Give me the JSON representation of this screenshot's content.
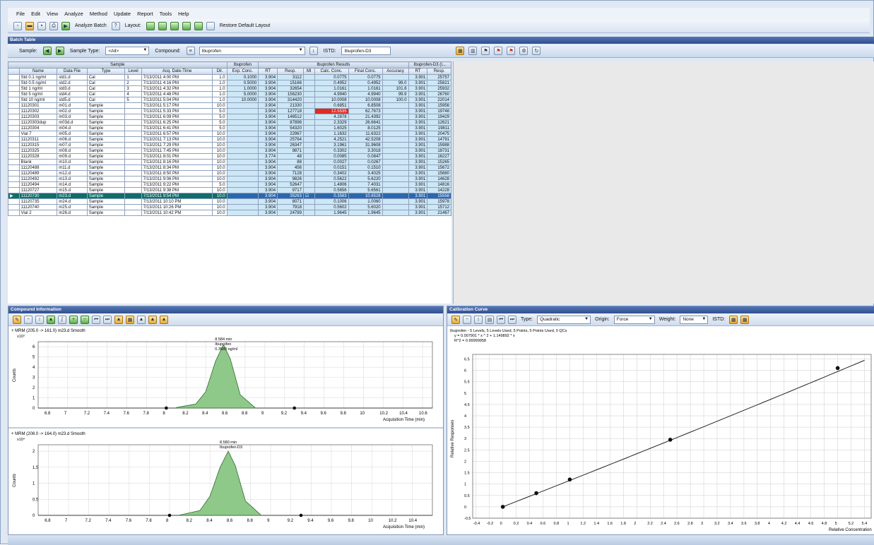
{
  "menu": [
    "File",
    "Edit",
    "View",
    "Analyze",
    "Method",
    "Update",
    "Report",
    "Tools",
    "Help"
  ],
  "toolbar": {
    "analyze_batch": "Analyze Batch",
    "layout": "Layout:",
    "restore_layout": "Restore Default Layout"
  },
  "batch_table_title": "Batch Table",
  "filter": {
    "sample_label": "Sample:",
    "sample_type_label": "Sample Type:",
    "sample_type_value": "<All>",
    "compound_label": "Compound:",
    "compound_value": "Ibuprofen",
    "istd_label": "ISTD:",
    "istd_value": "Ibuprofen-D3"
  },
  "group_headers": {
    "sample": "Sample",
    "istd_group": "Ibuprofen",
    "results": "Ibuprofen Results",
    "istd_results": "Ibuprofen-D3 (I..."
  },
  "columns": [
    "",
    "Name",
    "Data File",
    "Type",
    "Level",
    "Acq. Date-Time",
    "Dil.",
    "Exp. Conc.",
    "RT",
    "Resp.",
    "MI",
    "Calc. Conc.",
    "Final Conc.",
    "Accuracy",
    "RT",
    "Resp."
  ],
  "rows": [
    [
      "",
      "Std 0.1 ng/ml",
      "std1.d",
      "Cal",
      "1",
      "7/13/2011 4:00 PM",
      "1.0",
      "0.1000",
      "3.904",
      "3112",
      "",
      "0.0775",
      "0.0775",
      "",
      "3.901",
      "25757"
    ],
    [
      "",
      "Std 0.5 ng/ml",
      "std2.d",
      "Cal",
      "2",
      "7/13/2011 4:16 PM",
      "1.0",
      "0.5000",
      "3.904",
      "15166",
      "",
      "0.4952",
      "0.4952",
      "99.0",
      "3.901",
      "25821"
    ],
    [
      "",
      "Std 1 ng/ml",
      "std3.d",
      "Cal",
      "3",
      "7/13/2011 4:32 PM",
      "1.0",
      "1.0000",
      "3.904",
      "32654",
      "",
      "1.0161",
      "1.0161",
      "101.6",
      "3.901",
      "25932"
    ],
    [
      "",
      "Std 5 ng/ml",
      "std4.d",
      "Cal",
      "4",
      "7/13/2011 4:48 PM",
      "1.0",
      "5.0000",
      "3.904",
      "156230",
      "",
      "4.9940",
      "4.9940",
      "99.9",
      "3.901",
      "26760"
    ],
    [
      "",
      "Std 10 ng/ml",
      "std5.d",
      "Cal",
      "5",
      "7/13/2011 5:04 PM",
      "1.0",
      "10.0000",
      "3.904",
      "314420",
      "",
      "10.0008",
      "10.0008",
      "100.0",
      "3.901",
      "22014"
    ],
    [
      "",
      "11120301",
      "m01.d",
      "Sample",
      "",
      "7/13/2011 5:17 PM",
      "10.0",
      "",
      "3.904",
      "21330",
      "",
      "0.6851",
      "6.8508",
      "",
      "3.901",
      "15956"
    ],
    [
      "",
      "11120302",
      "m02.d",
      "Sample",
      "",
      "7/13/2011 5:33 PM",
      "5.0",
      "",
      "3.904",
      "127718",
      "",
      "12.5535",
      "62.7673",
      "",
      "3.901",
      "19748"
    ],
    [
      "",
      "11120303",
      "m03.d",
      "Sample",
      "",
      "7/13/2011 6:09 PM",
      "5.0",
      "",
      "3.904",
      "146512",
      "",
      "4.2878",
      "21.4392",
      "",
      "3.901",
      "19429"
    ],
    [
      "",
      "11120303dup",
      "m03d.d",
      "Sample",
      "",
      "7/13/2011 6:25 PM",
      "5.0",
      "",
      "3.904",
      "87898",
      "",
      "2.3329",
      "26.6641",
      "",
      "3.901",
      "12621"
    ],
    [
      "",
      "11120304",
      "m04.d",
      "Sample",
      "",
      "7/13/2011 6:41 PM",
      "5.0",
      "",
      "3.904",
      "54320",
      "",
      "1.6025",
      "8.0125",
      "",
      "3.901",
      "19811"
    ],
    [
      "",
      "Vial 7",
      "m05.d",
      "Sample",
      "",
      "7/13/2011 6:57 PM",
      "10.0",
      "",
      "3.904",
      "22967",
      "",
      "1.1632",
      "11.6322",
      "",
      "3.901",
      "20475"
    ],
    [
      "",
      "11120311",
      "m06.d",
      "Sample",
      "",
      "7/13/2011 7:13 PM",
      "10.0",
      "",
      "3.904",
      "25764",
      "",
      "4.2521",
      "42.5208",
      "",
      "3.901",
      "14791"
    ],
    [
      "",
      "11120315",
      "m07.d",
      "Sample",
      "",
      "7/13/2011 7:29 PM",
      "10.0",
      "",
      "3.904",
      "26347",
      "",
      "3.1961",
      "31.9608",
      "",
      "3.901",
      "15988"
    ],
    [
      "",
      "11120325",
      "m08.d",
      "Sample",
      "",
      "7/13/2011 7:45 PM",
      "10.0",
      "",
      "3.904",
      "9871",
      "",
      "0.3302",
      "3.3018",
      "",
      "3.901",
      "18731"
    ],
    [
      "",
      "11120328",
      "m09.d",
      "Sample",
      "",
      "7/13/2011 8:01 PM",
      "10.0",
      "",
      "3.774",
      "48",
      "",
      "0.0085",
      "0.0847",
      "",
      "3.901",
      "16227"
    ],
    [
      "",
      "Blank",
      "m10.d",
      "Sample",
      "",
      "7/13/2011 8:16 PM",
      "10.0",
      "",
      "3.904",
      "88",
      "",
      "0.0027",
      "0.0267",
      "",
      "3.901",
      "15265"
    ],
    [
      "",
      "11120488",
      "m11.d",
      "Sample",
      "",
      "7/13/2011 8:34 PM",
      "10.0",
      "",
      "3.904",
      "456",
      "",
      "0.0151",
      "0.1510",
      "",
      "3.901",
      "15672"
    ],
    [
      "",
      "11120489",
      "m12.d",
      "Sample",
      "",
      "7/13/2011 8:50 PM",
      "10.0",
      "",
      "3.904",
      "7128",
      "",
      "0.3402",
      "3.4025",
      "",
      "3.901",
      "15880"
    ],
    [
      "",
      "11120492",
      "m13.d",
      "Sample",
      "",
      "7/13/2011 9:06 PM",
      "10.0",
      "",
      "3.904",
      "9826",
      "",
      "0.5622",
      "5.6220",
      "",
      "3.901",
      "14628"
    ],
    [
      "",
      "11120494",
      "m14.d",
      "Sample",
      "",
      "7/13/2011 9:22 PM",
      "5.0",
      "",
      "3.904",
      "52647",
      "",
      "1.4806",
      "7.4031",
      "",
      "3.901",
      "14816"
    ],
    [
      "",
      "11120727",
      "m15.d",
      "Sample",
      "",
      "7/13/2011 9:38 PM",
      "10.0",
      "",
      "3.904",
      "9717",
      "",
      "0.5656",
      "5.6561",
      "",
      "3.901",
      "14228"
    ],
    [
      "▶",
      "11120730",
      "m23.d",
      "Sample",
      "",
      "7/13/2011 9:54 PM",
      "10.0",
      "",
      "3.904",
      "35263",
      "☑",
      "0.3583",
      "10.8528",
      "",
      "3.901",
      "15558"
    ],
    [
      "",
      "11120735",
      "m24.d",
      "Sample",
      "",
      "7/13/2011 10:10 PM",
      "10.0",
      "",
      "3.904",
      "8071",
      "",
      "0.1006",
      "1.0060",
      "",
      "3.901",
      "15978"
    ],
    [
      "",
      "11120740",
      "m25.d",
      "Sample",
      "",
      "7/13/2011 10:26 PM",
      "10.0",
      "",
      "3.904",
      "7918",
      "",
      "0.5602",
      "5.6020",
      "",
      "3.901",
      "15712"
    ],
    [
      "",
      "Vial 2",
      "m26.d",
      "Sample",
      "",
      "7/13/2011 10:42 PM",
      "10.0",
      "",
      "3.904",
      "24789",
      "",
      "1.9645",
      "1.9645",
      "",
      "3.901",
      "21467"
    ]
  ],
  "compound_panel": {
    "title": "Compound Information",
    "plot1": {
      "title": "+ MRM (205.0 -> 161.0) m23.d Smooth",
      "peak_label": "8.584 min",
      "peak_label2": "Ibuprofen",
      "peak_label3": "0.3583 ng/ml",
      "ylabel": "Counts",
      "exp": "x10³",
      "y_ticks": [
        "6",
        "5",
        "4",
        "3",
        "2",
        "1",
        "0"
      ],
      "x_ticks": [
        "6.8",
        "7",
        "7.2",
        "7.4",
        "7.6",
        "7.8",
        "8",
        "8.2",
        "8.4",
        "8.6",
        "8.8",
        "9",
        "9.2",
        "9.4",
        "9.6",
        "9.8",
        "10",
        "10.2",
        "10.4",
        "10.6"
      ],
      "xlabel": "Acquisition Time (min)"
    },
    "plot2": {
      "title": "+ MRM (208.0 -> 164.0) m23.d Smooth",
      "peak_label": "8.580 min",
      "peak_label2": "Ibuprofen-D3",
      "ylabel": "Counts",
      "exp": "x10⁴",
      "y_ticks": [
        "2",
        "1.5",
        "1",
        "0.5",
        "0"
      ],
      "x_ticks": [
        "6.8",
        "7",
        "7.2",
        "7.4",
        "7.6",
        "7.8",
        "8",
        "8.2",
        "8.4",
        "8.6",
        "8.8",
        "9",
        "9.2",
        "9.4",
        "9.6",
        "9.8",
        "10",
        "10.2",
        "10.4"
      ],
      "xlabel": "Acquisition Time (min)"
    }
  },
  "calib_panel": {
    "title": "Calibration Curve",
    "type_label": "Type:",
    "type_value": "Quadratic",
    "origin_label": "Origin:",
    "origin_value": "Force",
    "weight_label": "Weight:",
    "weight_value": "None",
    "istd_label": "ISTD:",
    "info1": "Ibuprofen - 5 Levels, 5 Levels Used, 5 Points, 5 Points Used, 0 QCs",
    "info2": "y = 0.007901 * x ^ 2 + 1.149892 * x",
    "info3": "R^2 = 0.99999958",
    "ylabel": "Relative Responses",
    "xlabel": "Relative Concentration",
    "y_ticks": [
      "6.5",
      "6",
      "5.5",
      "5",
      "4.5",
      "4",
      "3.5",
      "3",
      "2.5",
      "2",
      "1.5",
      "1",
      "0.5",
      "0",
      "-0.5"
    ],
    "x_ticks": [
      "-0.4",
      "-0.2",
      "0",
      "0.2",
      "0.4",
      "0.6",
      "0.8",
      "1",
      "1.2",
      "1.4",
      "1.6",
      "1.8",
      "2",
      "2.2",
      "2.4",
      "2.6",
      "2.8",
      "3",
      "3.2",
      "3.4",
      "3.6",
      "3.8",
      "4",
      "4.2",
      "4.4",
      "4.6",
      "4.8",
      "5",
      "5.2",
      "5.4"
    ]
  },
  "chart_data": [
    {
      "type": "area",
      "title": "+ MRM (205.0 -> 161.0) m23.d Smooth",
      "xlabel": "Acquisition Time (min)",
      "ylabel": "Counts",
      "x": [
        8.1,
        8.3,
        8.4,
        8.5,
        8.58,
        8.65,
        8.75,
        8.9
      ],
      "values": [
        0.05,
        0.4,
        1.6,
        4.6,
        6.2,
        4.8,
        1.3,
        0.05
      ],
      "xlim": [
        6.7,
        10.7
      ],
      "ylim": [
        0,
        6.5
      ]
    },
    {
      "type": "area",
      "title": "+ MRM (208.0 -> 164.0) m23.d Smooth",
      "xlabel": "Acquisition Time (min)",
      "ylabel": "Counts",
      "x": [
        8.1,
        8.3,
        8.4,
        8.5,
        8.58,
        8.65,
        8.75,
        8.9
      ],
      "values": [
        0.01,
        0.15,
        0.6,
        1.5,
        2.0,
        1.55,
        0.45,
        0.02
      ],
      "xlim": [
        6.7,
        10.6
      ],
      "ylim": [
        0,
        2.2
      ]
    },
    {
      "type": "scatter",
      "title": "",
      "xlabel": "Relative Concentration",
      "ylabel": "Relative Responses",
      "x": [
        0.0,
        0.5,
        1.0,
        2.5,
        5.0
      ],
      "values": [
        0.0,
        0.6,
        1.2,
        2.95,
        6.1
      ],
      "xlim": [
        -0.45,
        5.5
      ],
      "ylim": [
        -0.5,
        6.7
      ]
    }
  ]
}
